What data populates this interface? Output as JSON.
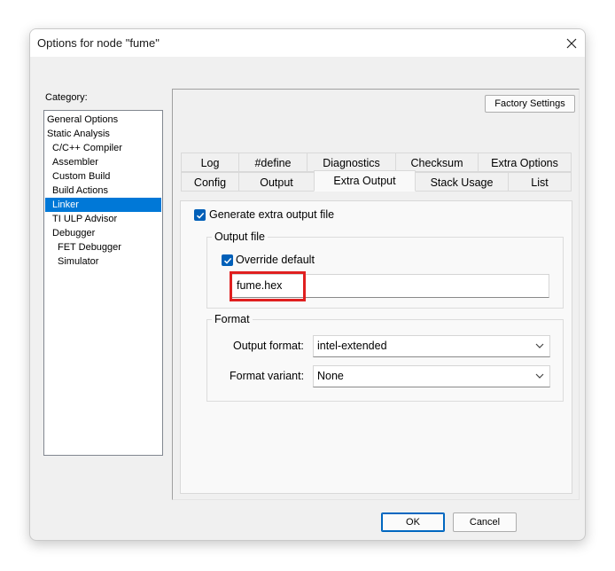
{
  "window": {
    "title": "Options for node \"fume\""
  },
  "category": {
    "label": "Category:",
    "items": [
      {
        "label": "General Options"
      },
      {
        "label": "Static Analysis"
      },
      {
        "label": "C/C++ Compiler"
      },
      {
        "label": "Assembler"
      },
      {
        "label": "Custom Build"
      },
      {
        "label": "Build Actions"
      },
      {
        "label": "Linker"
      },
      {
        "label": "TI ULP Advisor"
      },
      {
        "label": "Debugger"
      },
      {
        "label": "FET Debugger"
      },
      {
        "label": "Simulator"
      }
    ],
    "selected": "Linker"
  },
  "buttons": {
    "factory_settings": "Factory Settings",
    "ok": "OK",
    "cancel": "Cancel"
  },
  "tabs": {
    "row1": [
      "Log",
      "#define",
      "Diagnostics",
      "Checksum",
      "Extra Options"
    ],
    "row2": [
      "Config",
      "Output",
      "Extra Output",
      "Stack Usage",
      "List"
    ],
    "active": "Extra Output"
  },
  "extra_output": {
    "generate_label": "Generate extra output file",
    "generate_checked": true,
    "output_file": {
      "group_label": "Output file",
      "override_label": "Override default",
      "override_checked": true,
      "filename": "fume.hex"
    },
    "format": {
      "group_label": "Format",
      "output_format_label": "Output format:",
      "output_format_value": "intel-extended",
      "format_variant_label": "Format variant:",
      "format_variant_value": "None"
    }
  },
  "colors": {
    "accent": "#0078d7",
    "highlight": "#e02020",
    "checkbox": "#005fb8"
  },
  "icons": {
    "close": "close-icon",
    "check": "checkmark-icon",
    "dropdown": "chevron-down-icon"
  }
}
